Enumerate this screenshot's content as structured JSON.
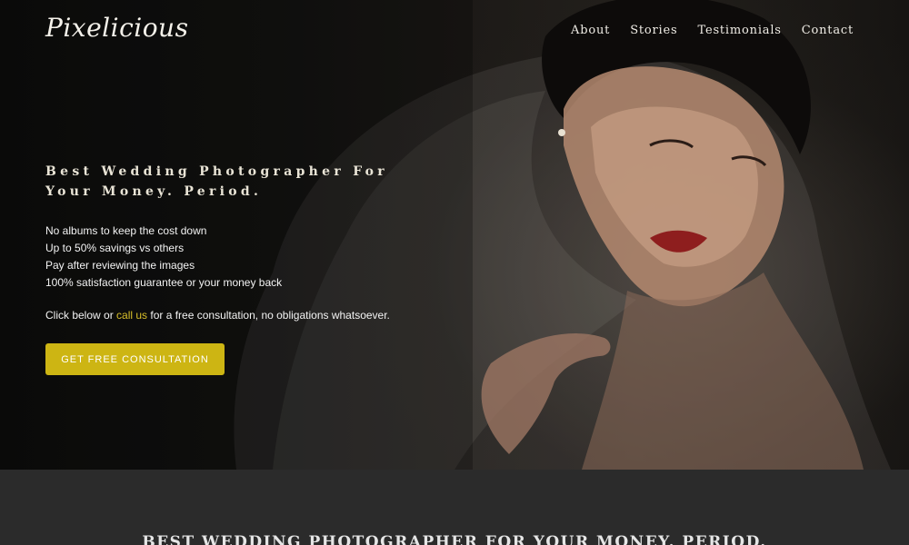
{
  "brand": {
    "logo": "Pixelicious"
  },
  "nav": {
    "items": [
      "About",
      "Stories",
      "Testimonials",
      "Contact"
    ]
  },
  "hero": {
    "headline": "Best Wedding Photographer For Your Money. Period.",
    "bullets": [
      "No albums to keep the cost down",
      "Up to 50% savings vs others",
      "Pay after reviewing the images",
      "100% satisfaction guarantee or your money back"
    ],
    "consult_before": "Click below or ",
    "consult_link": "call us",
    "consult_after": " for a free consultation, no obligations whatsoever.",
    "cta_label": "GET FREE CONSULTATION",
    "photo_icon": "bride-with-veil-photo"
  },
  "lower": {
    "title": "Best Wedding Photographer For Your Money. Period."
  },
  "colors": {
    "accent": "#cdb513",
    "link": "#d8bf2a",
    "background": "#2b2b2b"
  }
}
